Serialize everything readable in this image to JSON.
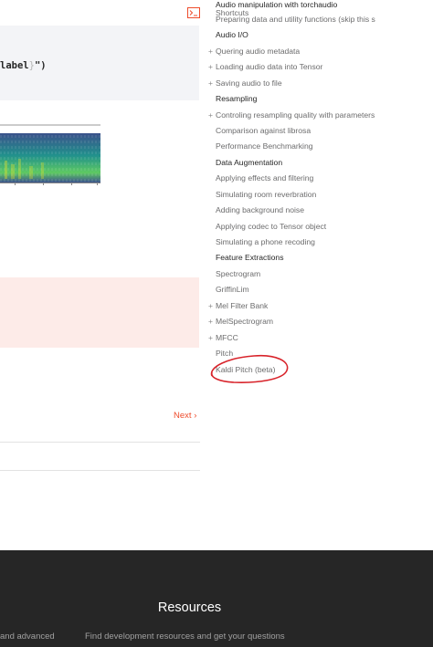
{
  "main": {
    "code_snippet": {
      "prefix": "label",
      "brace": "}",
      "suffix": "\")"
    },
    "next_link": "Next"
  },
  "sidebar": {
    "title": "Audio manipulation with torchaudio",
    "items": [
      {
        "label": "Shortcuts",
        "type": "item",
        "expandable": false
      },
      {
        "label": "Preparing data and utility functions (skip this s",
        "type": "item",
        "expandable": false
      },
      {
        "label": "Audio I/O",
        "type": "section",
        "expandable": false
      },
      {
        "label": "Quering audio metadata",
        "type": "item",
        "expandable": true
      },
      {
        "label": "Loading audio data into Tensor",
        "type": "item",
        "expandable": true
      },
      {
        "label": "Saving audio to file",
        "type": "item",
        "expandable": true
      },
      {
        "label": "Resampling",
        "type": "section",
        "expandable": false
      },
      {
        "label": "Controling resampling quality with parameters",
        "type": "item",
        "expandable": true
      },
      {
        "label": "Comparison against librosa",
        "type": "item",
        "expandable": false
      },
      {
        "label": "Performance Benchmarking",
        "type": "item",
        "expandable": false
      },
      {
        "label": "Data Augmentation",
        "type": "section",
        "expandable": false
      },
      {
        "label": "Applying effects and filtering",
        "type": "item",
        "expandable": false
      },
      {
        "label": "Simulating room reverbration",
        "type": "item",
        "expandable": false
      },
      {
        "label": "Adding background noise",
        "type": "item",
        "expandable": false
      },
      {
        "label": "Applying codec to Tensor object",
        "type": "item",
        "expandable": false
      },
      {
        "label": "Simulating a phone recoding",
        "type": "item",
        "expandable": false
      },
      {
        "label": "Feature Extractions",
        "type": "section",
        "expandable": false
      },
      {
        "label": "Spectrogram",
        "type": "item",
        "expandable": false
      },
      {
        "label": "GriffinLim",
        "type": "item",
        "expandable": false
      },
      {
        "label": "Mel Filter Bank",
        "type": "item",
        "expandable": true
      },
      {
        "label": "MelSpectrogram",
        "type": "item",
        "expandable": true
      },
      {
        "label": "MFCC",
        "type": "item",
        "expandable": true
      },
      {
        "label": "Pitch",
        "type": "item",
        "expandable": false
      },
      {
        "label": "Kaldi Pitch (beta)",
        "type": "item",
        "expandable": false
      }
    ]
  },
  "footer": {
    "title": "Resources",
    "left_text": "and advanced",
    "mid_text": "Find development resources and get your questions"
  },
  "colors": {
    "accent": "#ee4c2c",
    "annotation": "#d8232a",
    "footer_bg": "#262626"
  }
}
